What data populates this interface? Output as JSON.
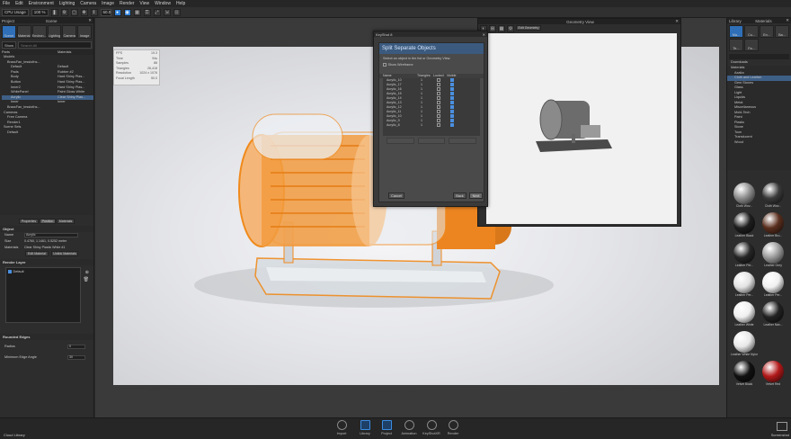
{
  "menu": [
    "File",
    "Edit",
    "Environment",
    "Lighting",
    "Camera",
    "Image",
    "Render",
    "View",
    "Window",
    "Help"
  ],
  "toolbar": {
    "cpu_label": "CPU Usage",
    "cpu_value": "100 %",
    "zoom": "60.0"
  },
  "project_panel": {
    "title": "Project",
    "scene_title": "Scene",
    "tabs": [
      "Scene",
      "Material",
      "Environ...",
      "Lighting",
      "Camera",
      "Image"
    ],
    "search_filter": "Show",
    "search_placeholder": "Search All",
    "columns": [
      "Parts",
      "Materials"
    ],
    "tree": [
      {
        "name": "Models",
        "mat": ""
      },
      {
        "name": "BrassFan_tessloths...",
        "mat": ""
      },
      {
        "name": "Default",
        "mat": "Default"
      },
      {
        "name": "Pads",
        "mat": "Rubber #2"
      },
      {
        "name": "Body",
        "mat": "Hard Shiny Plas..."
      },
      {
        "name": "Button",
        "mat": "Hard Shiny Plas..."
      },
      {
        "name": "Inner2",
        "mat": "Hard Shiny Plas..."
      },
      {
        "name": "WhitePanel",
        "mat": "Paint Gloss White"
      },
      {
        "name": "Acrylic",
        "mat": "Clear Shiny Plas..."
      },
      {
        "name": "Inner",
        "mat": "Inner"
      },
      {
        "name": "BrassFan_tessloths...",
        "mat": ""
      },
      {
        "name": "Cameras",
        "mat": ""
      },
      {
        "name": "Free Camera",
        "mat": ""
      },
      {
        "name": "Render1",
        "mat": ""
      },
      {
        "name": "Scene Sets",
        "mat": ""
      },
      {
        "name": "Default",
        "mat": ""
      }
    ],
    "bottom_tabs": [
      "Properties",
      "Position",
      "Materials"
    ]
  },
  "properties": {
    "object_header": "Object",
    "name_label": "Name",
    "name_value": "Acrylic",
    "size_label": "Size",
    "size_value": "0.4760, 1.1461, 0.5252 meter",
    "material_label": "Materials",
    "material_value": "Clear Shiny Plastic White #1",
    "edit_material": "Edit Material",
    "unlink_material": "Unlink Materials",
    "render_layer_header": "Render Layer",
    "render_layer_item": "Default",
    "rounded_header": "Rounded Edges",
    "radius_label": "Radius",
    "radius_value": "0",
    "angle_label": "Minimum Edge Angle",
    "angle_value": "30"
  },
  "stats": [
    {
      "k": "FPS",
      "v": "19.3"
    },
    {
      "k": "Time",
      "v": "94s"
    },
    {
      "k": "Samples",
      "v": "88"
    },
    {
      "k": "Triangles",
      "v": "26,418"
    },
    {
      "k": "Resolution",
      "v": "1024 x 1076"
    },
    {
      "k": "Focal Length",
      "v": "50.0"
    }
  ],
  "dialog": {
    "window_title": "KeyShot 8",
    "header": "Split Separate Objects",
    "instruction": "Select an object in the list or Geometry View.",
    "show_wireframe": "Show Wireframe",
    "columns": [
      "Name",
      "Triangles",
      "Locked",
      "Visible"
    ],
    "rows": [
      {
        "name": "Acrylic_10",
        "tri": "1"
      },
      {
        "name": "Acrylic_17",
        "tri": "1"
      },
      {
        "name": "Acrylic_16",
        "tri": "1"
      },
      {
        "name": "Acrylic_15",
        "tri": "1"
      },
      {
        "name": "Acrylic_14",
        "tri": "1"
      },
      {
        "name": "Acrylic_13",
        "tri": "1"
      },
      {
        "name": "Acrylic_12",
        "tri": "1"
      },
      {
        "name": "Acrylic_11",
        "tri": "1"
      },
      {
        "name": "Acrylic_10",
        "tri": "1"
      },
      {
        "name": "Acrylic_9",
        "tri": "1"
      },
      {
        "name": "Acrylic_8",
        "tri": "1"
      }
    ],
    "cancel": "Cancel",
    "back": "Back",
    "next": "Next"
  },
  "geometry_view": {
    "title": "Geometry View",
    "edit_geometry": "Edit Geometry"
  },
  "library": {
    "title": "Library",
    "materials_title": "Materials",
    "tabs": [
      "Ma...",
      "Co...",
      "En...",
      "Ba...",
      "Te...",
      "Fa..."
    ],
    "section": "Downloads",
    "items": [
      "Materials",
      "Axalta",
      "Cloth and Leather",
      "Gem Stones",
      "Glass",
      "Light",
      "Liquids",
      "Metal",
      "Miscellaneous",
      "Mold-Tech",
      "Paint",
      "Plastic",
      "Stone",
      "Toon",
      "Translucent",
      "Wood"
    ],
    "swatches": [
      {
        "label": "Cloth Wov...",
        "color": "#8c8c8c"
      },
      {
        "label": "Cloth Wov...",
        "color": "#3a3a3a"
      },
      {
        "label": "Leather Black",
        "color": "#1e1e1e"
      },
      {
        "label": "Leather Bro...",
        "color": "#5a2f1e"
      },
      {
        "label": "Leather Per...",
        "color": "#262626"
      },
      {
        "label": "Leather Grey",
        "color": "#9a9a9a"
      },
      {
        "label": "Leather Per...",
        "color": "#e2e2e2"
      },
      {
        "label": "Leather Per...",
        "color": "#f0f0f0"
      },
      {
        "label": "Leather White",
        "color": "#efefef"
      },
      {
        "label": "Leather Nav...",
        "color": "#222222"
      },
      {
        "label": "Leather White Nylon Fabric",
        "color": "#e8e8e8"
      },
      {
        "label": "",
        "color": ""
      },
      {
        "label": "Velvet Black",
        "color": "#111111"
      },
      {
        "label": "Velvet Red",
        "color": "#b3191a"
      }
    ]
  },
  "bottom": {
    "cloud_library": "Cloud Library",
    "items": [
      "Import",
      "Library",
      "Project",
      "Animation",
      "KeyShotXR",
      "Render"
    ],
    "screenshot": "Screenshot"
  },
  "colors": {
    "accent": "#2f7fd6",
    "orange": "#f08a1c"
  }
}
